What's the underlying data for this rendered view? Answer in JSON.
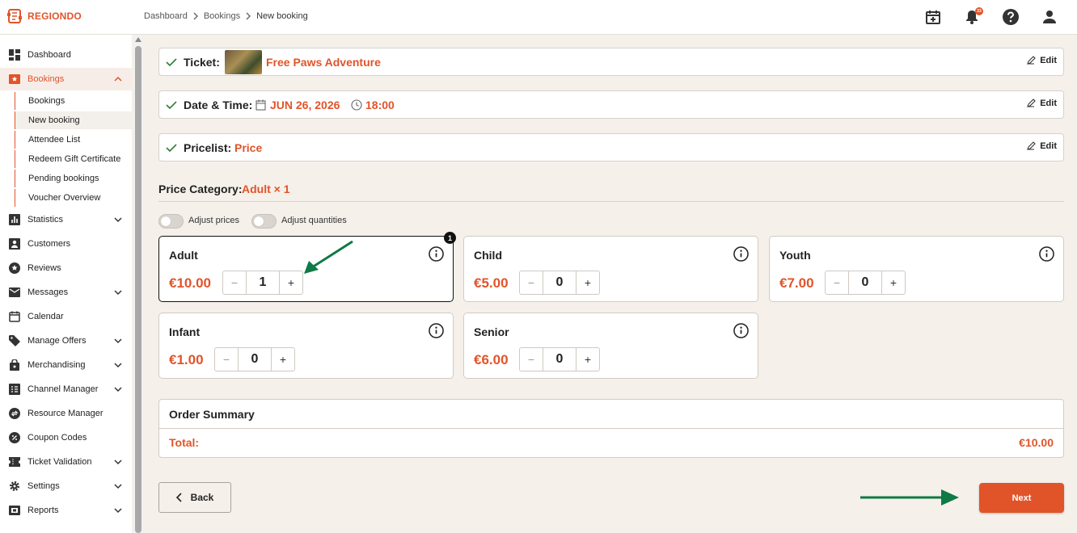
{
  "brand": {
    "name": "REGIONDO",
    "accent": "#e1542a"
  },
  "breadcrumb": [
    "Dashboard",
    "Bookings",
    "New booking"
  ],
  "topbar": {
    "notification_count": "23",
    "icons": [
      "calendar-plus-icon",
      "bell-icon",
      "help-icon",
      "user-icon"
    ]
  },
  "sidebar": {
    "items": [
      {
        "label": "Dashboard",
        "icon": "dashboard-icon"
      },
      {
        "label": "Bookings",
        "icon": "bookings-icon"
      },
      {
        "label": "Statistics",
        "icon": "statistics-icon"
      },
      {
        "label": "Customers",
        "icon": "customers-icon"
      },
      {
        "label": "Reviews",
        "icon": "star-icon"
      },
      {
        "label": "Messages",
        "icon": "mail-icon"
      },
      {
        "label": "Calendar",
        "icon": "calendar-icon"
      },
      {
        "label": "Manage Offers",
        "icon": "tag-icon"
      },
      {
        "label": "Merchandising",
        "icon": "bag-icon"
      },
      {
        "label": "Channel Manager",
        "icon": "channel-icon"
      },
      {
        "label": "Resource Manager",
        "icon": "resource-icon"
      },
      {
        "label": "Coupon Codes",
        "icon": "coupon-icon"
      },
      {
        "label": "Ticket Validation",
        "icon": "ticket-icon"
      },
      {
        "label": "Settings",
        "icon": "gear-icon"
      },
      {
        "label": "Reports",
        "icon": "reports-icon"
      }
    ],
    "bookings_sub": [
      "Bookings",
      "New booking",
      "Attendee List",
      "Redeem Gift Certificate",
      "Pending bookings",
      "Voucher Overview"
    ]
  },
  "steps": {
    "ticket": {
      "label": "Ticket:",
      "value": "Free Paws Adventure",
      "edit": "Edit"
    },
    "datetime": {
      "label": "Date & Time:",
      "date": "JUN 26, 2026",
      "time": "18:00",
      "edit": "Edit"
    },
    "pricelist": {
      "label": "Pricelist:",
      "value": "Price",
      "edit": "Edit"
    }
  },
  "price_category": {
    "label": "Price Category:",
    "value": "Adult × 1"
  },
  "toggles": {
    "adjust_prices": "Adjust prices",
    "adjust_quantities": "Adjust quantities"
  },
  "categories": [
    {
      "name": "Adult",
      "price": "€10.00",
      "qty": "1",
      "badge": "1"
    },
    {
      "name": "Child",
      "price": "€5.00",
      "qty": "0"
    },
    {
      "name": "Youth",
      "price": "€7.00",
      "qty": "0"
    },
    {
      "name": "Infant",
      "price": "€1.00",
      "qty": "0"
    },
    {
      "name": "Senior",
      "price": "€6.00",
      "qty": "0"
    }
  ],
  "stepper": {
    "minus": "−",
    "plus": "+"
  },
  "summary": {
    "title": "Order Summary",
    "total_label": "Total:",
    "total_value": "€10.00"
  },
  "actions": {
    "back": "Back",
    "next": "Next"
  }
}
